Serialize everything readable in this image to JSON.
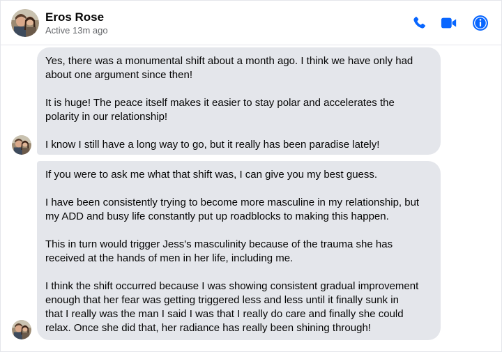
{
  "header": {
    "name": "Eros Rose",
    "status": "Active 13m ago",
    "icons": {
      "call": "phone-icon",
      "video": "video-camera-icon",
      "info": "info-icon"
    },
    "accent_color": "#0866ff"
  },
  "messages": [
    {
      "sender": "Eros Rose",
      "paragraphs": [
        "Yes, there was a monumental shift about a month ago.  I think we have only had\nabout one argument since then!",
        "It is huge!  The peace itself makes it easier to stay polar and accelerates the\npolarity in our relationship!",
        "I know I still have a long way to go, but it really has been paradise lately!"
      ]
    },
    {
      "sender": "Eros Rose",
      "paragraphs": [
        "If you were to ask me what that shift was, I can give you my best guess.",
        "I have been consistently trying to become more masculine in my relationship, but\nmy ADD and busy life constantly put up roadblocks to making this happen.",
        "This in turn would trigger Jess's masculinity because of the trauma she has\nreceived at the hands of men in her life, including me.",
        "I think the shift occurred because I was showing consistent gradual improvement\nenough that her fear was getting triggered less and less until it finally sunk in\nthat I really was the man I said I was that I really do care and finally she could\nrelax.  Once she did that, her radiance has really been shining through!"
      ]
    }
  ],
  "colors": {
    "bubble_background": "#e4e6eb",
    "secondary_text": "#65676b"
  }
}
